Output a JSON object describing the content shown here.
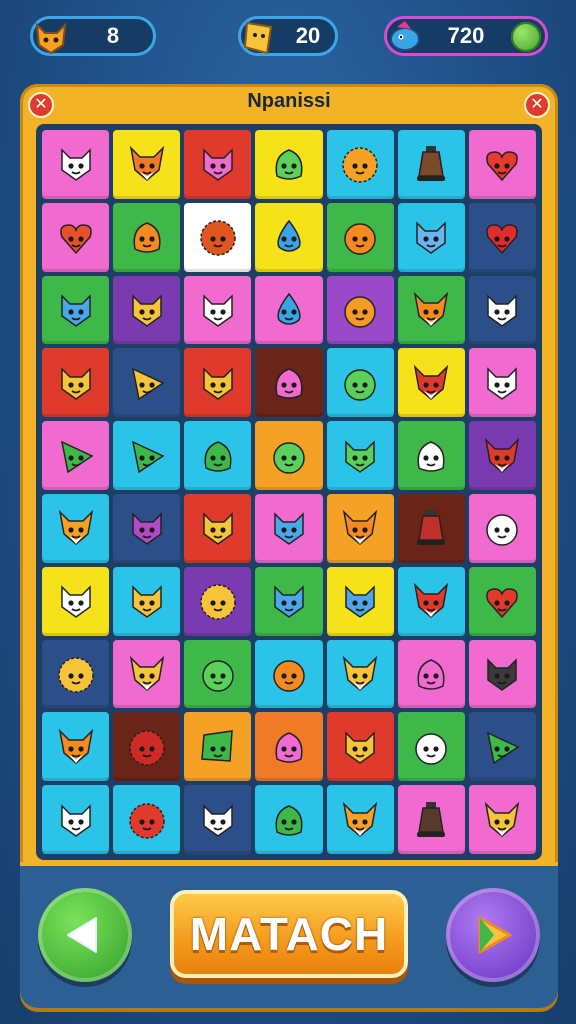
{
  "hud": {
    "fox_count": "8",
    "cards_count": "20",
    "coins": "720"
  },
  "board": {
    "title": "Npanissi",
    "close_left": "✕",
    "close_right": "✕",
    "rows": [
      [
        {
          "bg": "#f06ad0",
          "kind": "cat",
          "color": "#ffffff"
        },
        {
          "bg": "#f5e21a",
          "kind": "fox",
          "color": "#f07a26"
        },
        {
          "bg": "#e03a2c",
          "kind": "cat",
          "color": "#f06ad0"
        },
        {
          "bg": "#f5e21a",
          "kind": "blob",
          "color": "#5bd05a"
        },
        {
          "bg": "#2bc4e8",
          "kind": "lion",
          "color": "#f5a126"
        },
        {
          "bg": "#2bc4e8",
          "kind": "bell",
          "color": "#7a4a2a"
        },
        {
          "bg": "#f06ad0",
          "kind": "heart",
          "color": "#e83a2c"
        }
      ],
      [
        {
          "bg": "#f06ad0",
          "kind": "heart",
          "color": "#e8502c"
        },
        {
          "bg": "#3fb84a",
          "kind": "blob",
          "color": "#f58a20"
        },
        {
          "bg": "#ffffff",
          "kind": "lion",
          "color": "#e0561e"
        },
        {
          "bg": "#f5e21a",
          "kind": "drop",
          "color": "#3aa4e8"
        },
        {
          "bg": "#3fb84a",
          "kind": "round",
          "color": "#f58a20"
        },
        {
          "bg": "#2bc4e8",
          "kind": "cat",
          "color": "#6ab4f0"
        },
        {
          "bg": "#2c4f8a",
          "kind": "heart",
          "color": "#e02c2c"
        }
      ],
      [
        {
          "bg": "#3fb84a",
          "kind": "cat",
          "color": "#4aa8e8"
        },
        {
          "bg": "#7a3ab0",
          "kind": "cat",
          "color": "#f5c43a"
        },
        {
          "bg": "#f06ad0",
          "kind": "cat",
          "color": "#ffffff"
        },
        {
          "bg": "#f06ad0",
          "kind": "drop",
          "color": "#3aa4e8"
        },
        {
          "bg": "#9a4ac8",
          "kind": "round",
          "color": "#f59a26"
        },
        {
          "bg": "#3fb84a",
          "kind": "fox",
          "color": "#f58a20"
        },
        {
          "bg": "#2c4f8a",
          "kind": "cat",
          "color": "#ffffff"
        }
      ],
      [
        {
          "bg": "#e03a2c",
          "kind": "cat",
          "color": "#f5c43a"
        },
        {
          "bg": "#2c4f8a",
          "kind": "tri",
          "color": "#f5c43a"
        },
        {
          "bg": "#e03a2c",
          "kind": "cat",
          "color": "#f5c43a"
        },
        {
          "bg": "#6a2418",
          "kind": "blob",
          "color": "#f06ad0"
        },
        {
          "bg": "#2bc4e8",
          "kind": "round",
          "color": "#5bd05a"
        },
        {
          "bg": "#f5e21a",
          "kind": "fox",
          "color": "#e03a2c"
        },
        {
          "bg": "#f06ad0",
          "kind": "cat",
          "color": "#ffffff"
        }
      ],
      [
        {
          "bg": "#f06ad0",
          "kind": "tri",
          "color": "#3fb84a"
        },
        {
          "bg": "#2bc4e8",
          "kind": "tri",
          "color": "#3fb84a"
        },
        {
          "bg": "#2bc4e8",
          "kind": "blob",
          "color": "#3fb84a"
        },
        {
          "bg": "#f5a126",
          "kind": "round",
          "color": "#5bd05a"
        },
        {
          "bg": "#2bc4e8",
          "kind": "cat",
          "color": "#5bd05a"
        },
        {
          "bg": "#3fb84a",
          "kind": "blob",
          "color": "#ffffff"
        },
        {
          "bg": "#7a3ab0",
          "kind": "fox",
          "color": "#e03a2c"
        }
      ],
      [
        {
          "bg": "#2bc4e8",
          "kind": "fox",
          "color": "#f5a126"
        },
        {
          "bg": "#2c4f8a",
          "kind": "cat",
          "color": "#b04ac8"
        },
        {
          "bg": "#e03a2c",
          "kind": "cat",
          "color": "#f5c43a"
        },
        {
          "bg": "#f06ad0",
          "kind": "cat",
          "color": "#4aa8e8"
        },
        {
          "bg": "#f5a126",
          "kind": "fox",
          "color": "#f58a20"
        },
        {
          "bg": "#6a2418",
          "kind": "bell",
          "color": "#c0302a"
        },
        {
          "bg": "#f06ad0",
          "kind": "round",
          "color": "#ffffff"
        }
      ],
      [
        {
          "bg": "#f5e21a",
          "kind": "cat",
          "color": "#ffffff"
        },
        {
          "bg": "#2bc4e8",
          "kind": "cat",
          "color": "#f5c43a"
        },
        {
          "bg": "#7a3ab0",
          "kind": "lion",
          "color": "#f5c43a"
        },
        {
          "bg": "#3fb84a",
          "kind": "cat",
          "color": "#4aa8e8"
        },
        {
          "bg": "#f5e21a",
          "kind": "cat",
          "color": "#4aa8e8"
        },
        {
          "bg": "#2bc4e8",
          "kind": "fox",
          "color": "#e03a2c"
        },
        {
          "bg": "#3fb84a",
          "kind": "heart",
          "color": "#e03a2c"
        }
      ],
      [
        {
          "bg": "#2c4f8a",
          "kind": "lion",
          "color": "#f5c43a"
        },
        {
          "bg": "#f06ad0",
          "kind": "fox",
          "color": "#f5c43a"
        },
        {
          "bg": "#3fb84a",
          "kind": "round",
          "color": "#5bd05a"
        },
        {
          "bg": "#2bc4e8",
          "kind": "round",
          "color": "#f58a20"
        },
        {
          "bg": "#2bc4e8",
          "kind": "fox",
          "color": "#f5c43a"
        },
        {
          "bg": "#f06ad0",
          "kind": "blob",
          "color": "#f06ad0"
        },
        {
          "bg": "#f06ad0",
          "kind": "cat",
          "color": "#3a3a3a"
        }
      ],
      [
        {
          "bg": "#2bc4e8",
          "kind": "fox",
          "color": "#f58a20"
        },
        {
          "bg": "#6a2418",
          "kind": "lion",
          "color": "#d02a24"
        },
        {
          "bg": "#f5a126",
          "kind": "card",
          "color": "#3fb84a"
        },
        {
          "bg": "#f07a26",
          "kind": "blob",
          "color": "#f06ad0"
        },
        {
          "bg": "#e03a2c",
          "kind": "cat",
          "color": "#f5c43a"
        },
        {
          "bg": "#3fb84a",
          "kind": "round",
          "color": "#ffffff"
        },
        {
          "bg": "#2c4f8a",
          "kind": "tri",
          "color": "#3fb84a"
        }
      ],
      [
        {
          "bg": "#2bc4e8",
          "kind": "cat",
          "color": "#ffffff"
        },
        {
          "bg": "#2bc4e8",
          "kind": "lion",
          "color": "#e03a2c"
        },
        {
          "bg": "#2c4f8a",
          "kind": "cat",
          "color": "#ffffff"
        },
        {
          "bg": "#2bc4e8",
          "kind": "blob",
          "color": "#3fb84a"
        },
        {
          "bg": "#2bc4e8",
          "kind": "fox",
          "color": "#f5a126"
        },
        {
          "bg": "#f06ad0",
          "kind": "bell",
          "color": "#5a3a2a"
        },
        {
          "bg": "#f06ad0",
          "kind": "fox",
          "color": "#f5c43a"
        }
      ]
    ]
  },
  "controls": {
    "match_label": "MATACH",
    "prev_icon": "left-arrow-icon",
    "next_icon": "play-arrow-icon"
  }
}
